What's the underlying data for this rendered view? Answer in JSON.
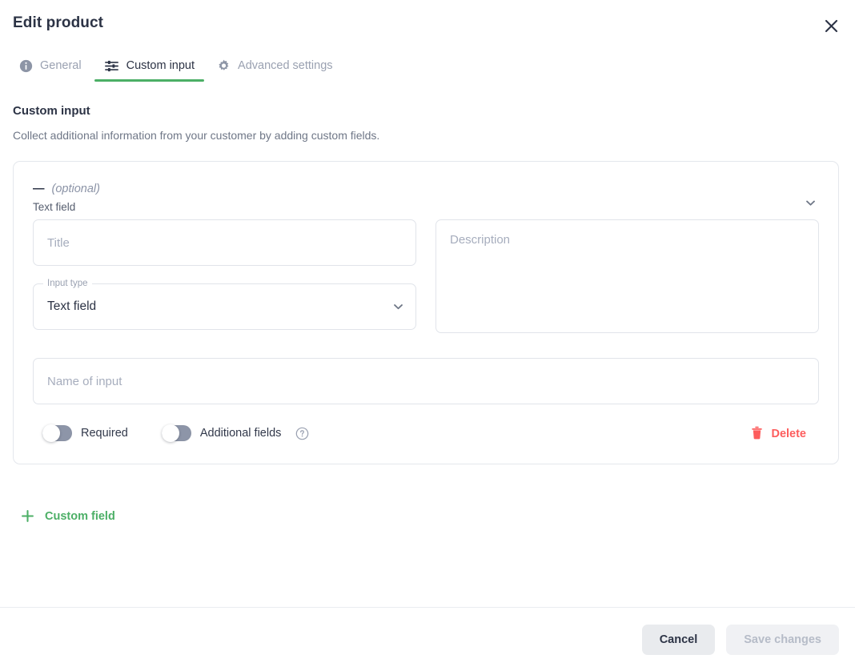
{
  "header": {
    "title": "Edit product",
    "close_icon": "close-icon"
  },
  "tabs": [
    {
      "id": "general",
      "label": "General",
      "icon": "info-circle-icon",
      "active": false
    },
    {
      "id": "custom-input",
      "label": "Custom input",
      "icon": "tune-sliders-icon",
      "active": true
    },
    {
      "id": "advanced-settings",
      "label": "Advanced settings",
      "icon": "gear-icon",
      "active": false
    }
  ],
  "section": {
    "title": "Custom input",
    "description": "Collect additional information from your customer by adding custom fields."
  },
  "custom_field_card": {
    "header": {
      "dash": "—",
      "optional_label": "(optional)",
      "type_label": "Text field",
      "collapse_icon": "chevron-down-icon"
    },
    "title_input": {
      "value": "",
      "placeholder": "Title"
    },
    "description_input": {
      "value": "",
      "placeholder": "Description"
    },
    "input_type_select": {
      "label": "Input type",
      "value": "Text field",
      "arrow_icon": "chevron-down-icon",
      "options": [
        "Text field"
      ]
    },
    "name_input": {
      "value": "",
      "placeholder": "Name of input"
    },
    "toggles": [
      {
        "id": "required",
        "label": "Required",
        "state": "off"
      },
      {
        "id": "additional-fields",
        "label": "Additional fields",
        "state": "off",
        "help_icon": "help-circle-icon"
      }
    ],
    "delete_button": {
      "label": "Delete",
      "icon": "trash-icon"
    }
  },
  "add_custom_field": {
    "label": "Custom field",
    "icon": "plus-icon"
  },
  "footer": {
    "cancel_label": "Cancel",
    "save_label": "Save changes",
    "save_disabled": true
  },
  "colors": {
    "accent_green": "#4caf66",
    "danger_red": "#fd5d5d",
    "text_dark": "#2c3345",
    "text_muted": "#8b93a6",
    "border": "#e1e4ea",
    "toggle_track_off": "#8d95a8"
  }
}
